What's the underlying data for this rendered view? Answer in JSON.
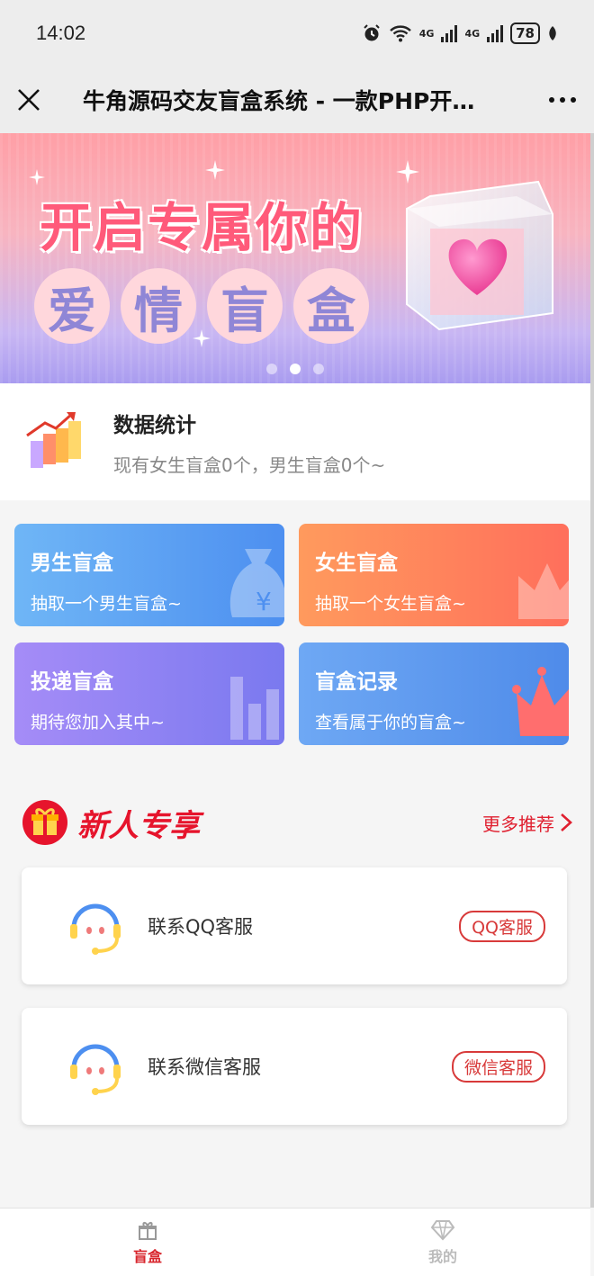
{
  "status_bar": {
    "time": "14:02",
    "network": "4G",
    "network2": "4G",
    "battery": "78"
  },
  "nav": {
    "title": "牛角源码交友盲盒系统 - 一款PHP开…"
  },
  "banner": {
    "line1": "开启专属你的",
    "line2": [
      "爱",
      "情",
      "盲",
      "盒"
    ],
    "active_dot": 1
  },
  "stats": {
    "title": "数据统计",
    "subtitle": "现有女生盲盒0个，男生盲盒0个~"
  },
  "cards": [
    {
      "title": "男生盲盒",
      "subtitle": "抽取一个男生盲盒~"
    },
    {
      "title": "女生盲盒",
      "subtitle": "抽取一个女生盲盒~"
    },
    {
      "title": "投递盲盒",
      "subtitle": "期待您加入其中~"
    },
    {
      "title": "盲盒记录",
      "subtitle": "查看属于你的盲盒~"
    }
  ],
  "section": {
    "title": "新人专享",
    "more": "更多推荐"
  },
  "services": [
    {
      "label": "联系QQ客服",
      "tag": "QQ客服"
    },
    {
      "label": "联系微信客服",
      "tag": "微信客服"
    }
  ],
  "tabs": [
    {
      "label": "盲盒",
      "active": true
    },
    {
      "label": "我的",
      "active": false
    }
  ],
  "colors": {
    "accent": "#d8262d",
    "nav_bg": "#ededed"
  }
}
